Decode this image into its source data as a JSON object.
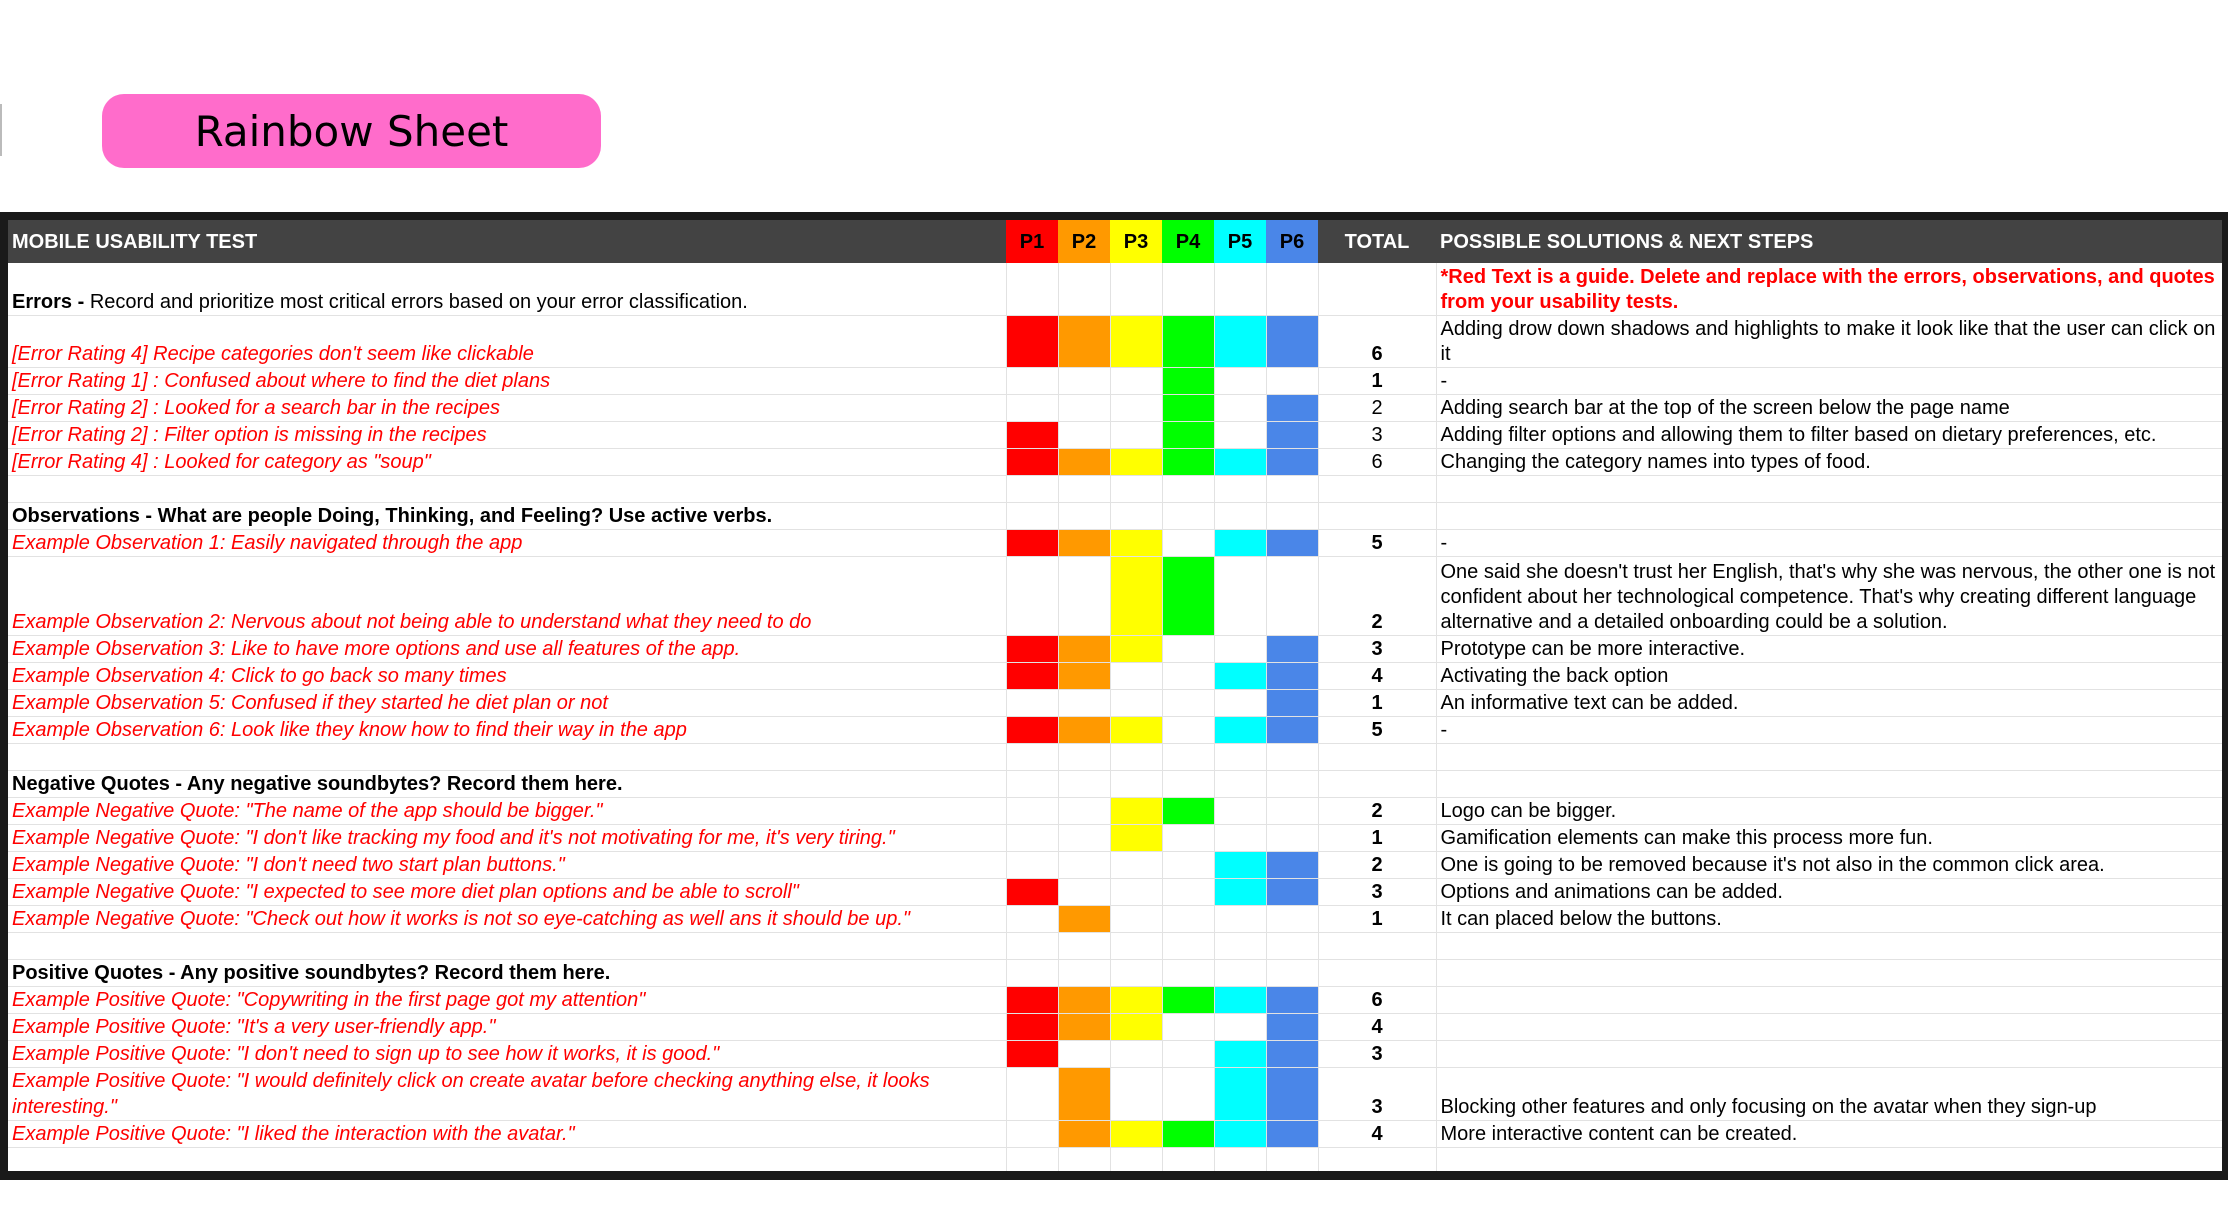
{
  "title": "Rainbow Sheet",
  "colors": {
    "pill": "#ff6ccb",
    "header_bg": "#434343",
    "P1": "#ff0000",
    "P2": "#ff9900",
    "P3": "#ffff00",
    "P4": "#00ff00",
    "P5": "#00ffff",
    "P6": "#4a86e8",
    "note_text": "#ff0000"
  },
  "header": {
    "test_label": "MOBILE USABILITY TEST",
    "participants": [
      "P1",
      "P2",
      "P3",
      "P4",
      "P5",
      "P6"
    ],
    "total_label": "TOTAL",
    "solutions_label": "POSSIBLE SOLUTIONS & NEXT STEPS"
  },
  "sections": [
    {
      "label_bold": "Errors - ",
      "label_rest": "Record and prioritize most critical errors based on your error classification.",
      "note": "*Red Text is a guide. Delete and replace with the errors, observations, and quotes from your usability tests.",
      "rows": [
        {
          "text": "[Error Rating 4] Recipe categories don't seem like clickable",
          "marks": [
            1,
            1,
            1,
            1,
            1,
            1
          ],
          "total": "6",
          "total_bold": true,
          "solution": "Adding drow down shadows and highlights to make it look like that the user  can click on it",
          "height": 52
        },
        {
          "text": "[Error Rating 1] : Confused about where to find the diet plans",
          "marks": [
            0,
            0,
            0,
            1,
            0,
            0
          ],
          "total": "1",
          "total_bold": true,
          "solution": "-",
          "height": 27
        },
        {
          "text": "[Error Rating 2] : Looked for a search bar in the recipes",
          "marks": [
            0,
            0,
            0,
            1,
            0,
            1
          ],
          "total": "2",
          "total_bold": false,
          "solution": "Adding search bar at the top of the screen below the page name",
          "height": 27
        },
        {
          "text": "[Error Rating 2] : Filter option is missing in the recipes",
          "marks": [
            1,
            0,
            0,
            1,
            0,
            1
          ],
          "total": "3",
          "total_bold": false,
          "solution": "Adding filter options and allowing them to filter based on dietary preferences, etc.",
          "height": 27
        },
        {
          "text": "[Error Rating 4] : Looked for category as \"soup\"",
          "marks": [
            1,
            1,
            1,
            1,
            1,
            1
          ],
          "total": "6",
          "total_bold": false,
          "solution": "Changing the category names into types of food.",
          "height": 27
        }
      ]
    },
    {
      "label_bold": "Observations - What are people Doing, Thinking, and Feeling? Use active verbs.",
      "label_rest": "",
      "rows": [
        {
          "text": "Example Observation 1: Easily navigated through the app",
          "marks": [
            1,
            1,
            1,
            0,
            1,
            1
          ],
          "total": "5",
          "total_bold": true,
          "solution": "-",
          "height": 27
        },
        {
          "text": "Example Observation 2: Nervous about not being able to understand what they need to do",
          "marks": [
            0,
            0,
            1,
            1,
            0,
            0
          ],
          "total": "2",
          "total_bold": true,
          "solution": "One said she doesn't trust her English, that's why she was nervous, the other one is not confident about her technological competence. That's why creating different language alternative and a detailed onboarding could be a solution.",
          "height": 79
        },
        {
          "text": "Example Observation 3: Like to have more options and use all features of the app.",
          "marks": [
            1,
            1,
            1,
            0,
            0,
            1
          ],
          "total": "3",
          "total_bold": true,
          "solution": "Prototype can be more interactive.",
          "height": 27
        },
        {
          "text": "Example Observation 4: Click to go back so many times",
          "marks": [
            1,
            1,
            0,
            0,
            1,
            1
          ],
          "total": "4",
          "total_bold": true,
          "solution": "Activating the back option",
          "height": 27
        },
        {
          "text": "Example Observation 5: Confused if they started he diet plan or not",
          "marks": [
            0,
            0,
            0,
            0,
            0,
            1
          ],
          "total": "1",
          "total_bold": true,
          "solution": "An informative text can be added.",
          "height": 27
        },
        {
          "text": "Example Observation 6: Look like they know how to find their way in the app",
          "marks": [
            1,
            1,
            1,
            0,
            1,
            1
          ],
          "total": "5",
          "total_bold": true,
          "solution": "-",
          "height": 27
        }
      ]
    },
    {
      "label_bold": "Negative Quotes - Any negative soundbytes? Record them here.",
      "label_rest": "",
      "rows": [
        {
          "text": "Example Negative Quote: \"The name of the app should be bigger.\"",
          "marks": [
            0,
            0,
            1,
            1,
            0,
            0
          ],
          "total": "2",
          "total_bold": true,
          "solution": "Logo can be bigger.",
          "height": 27
        },
        {
          "text": "Example Negative Quote: \"I don't like tracking my food and it's not motivating for me, it's very tiring.\"",
          "marks": [
            0,
            0,
            1,
            0,
            0,
            0
          ],
          "total": "1",
          "total_bold": true,
          "solution": "Gamification elements can make this process more fun.",
          "height": 27
        },
        {
          "text": "Example Negative Quote: \"I don't need two start plan buttons.\"",
          "marks": [
            0,
            0,
            0,
            0,
            1,
            1
          ],
          "total": "2",
          "total_bold": true,
          "solution": "One is going to be removed because it's not also in the common click area.",
          "height": 27
        },
        {
          "text": "Example Negative Quote: \"I expected to see more diet plan options and be able to scroll\"",
          "marks": [
            1,
            0,
            0,
            0,
            1,
            1
          ],
          "total": "3",
          "total_bold": true,
          "solution": "Options and animations can be added.",
          "height": 27
        },
        {
          "text": "Example Negative Quote: \"Check out how it works is not so eye-catching as well ans it should be up.\"",
          "marks": [
            0,
            1,
            0,
            0,
            0,
            0
          ],
          "total": "1",
          "total_bold": true,
          "solution": "It can placed below the buttons.",
          "height": 27
        }
      ]
    },
    {
      "label_bold": "Positive Quotes - Any positive soundbytes? Record them here.",
      "label_rest": "",
      "rows": [
        {
          "text": "Example Positive Quote: \"Copywriting in the first page got my attention\"",
          "marks": [
            1,
            1,
            1,
            1,
            1,
            1
          ],
          "total": "6",
          "total_bold": true,
          "solution": "",
          "height": 27
        },
        {
          "text": "Example Positive Quote: \"It's a very user-friendly app.\"",
          "marks": [
            1,
            1,
            1,
            0,
            0,
            1
          ],
          "total": "4",
          "total_bold": true,
          "solution": "",
          "height": 27
        },
        {
          "text": "Example Positive Quote: \"I don't need to sign up to see how it works, it is good.\"",
          "marks": [
            1,
            0,
            0,
            0,
            1,
            1
          ],
          "total": "3",
          "total_bold": true,
          "solution": "",
          "height": 27
        },
        {
          "text": "Example Positive Quote: \"I would definitely click on create avatar before checking anything else, it looks interesting.\"",
          "marks": [
            0,
            1,
            0,
            0,
            1,
            1
          ],
          "total": "3",
          "total_bold": true,
          "solution": "Blocking other features and only focusing on the avatar when they sign-up",
          "height": 52
        },
        {
          "text": "Example Positive Quote: \"I liked the interaction with the avatar.\"",
          "marks": [
            0,
            1,
            1,
            1,
            1,
            1
          ],
          "total": "4",
          "total_bold": true,
          "solution": "More interactive content can be created.",
          "height": 27
        }
      ]
    }
  ]
}
